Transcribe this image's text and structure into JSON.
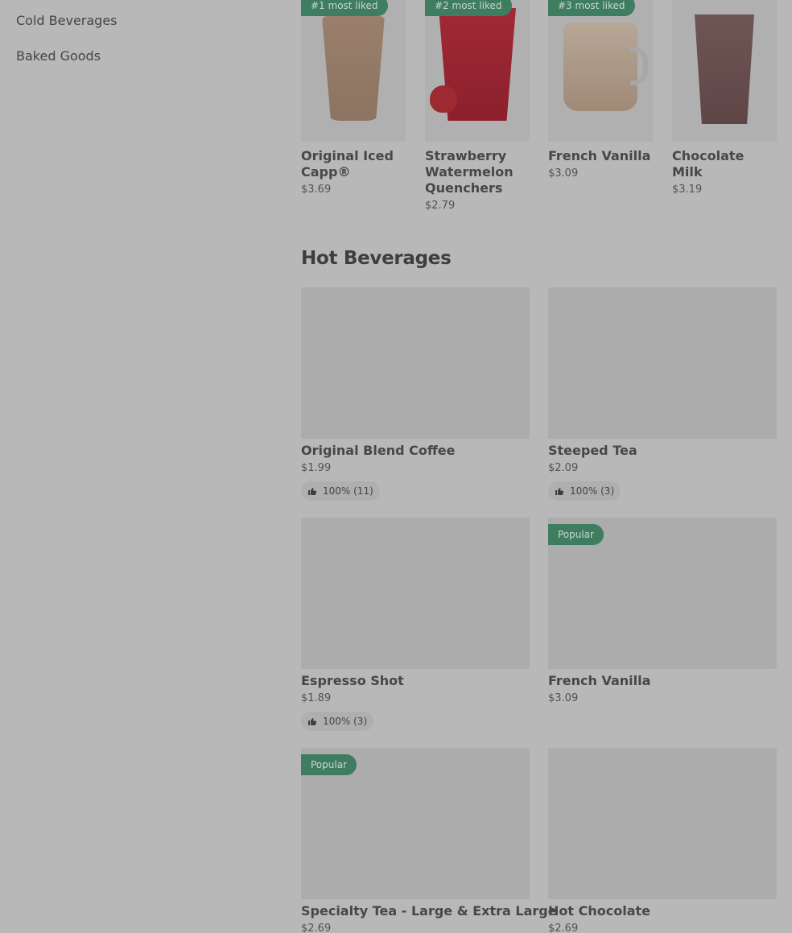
{
  "sidebar": {
    "items": [
      {
        "label": "Cold Beverages"
      },
      {
        "label": "Baked Goods"
      }
    ]
  },
  "most_liked": [
    {
      "badge": "#1 most liked",
      "title": "Original Iced Capp®",
      "price": "$3.69"
    },
    {
      "badge": "#2 most liked",
      "title": "Strawberry Watermelon Quenchers",
      "price": "$2.79"
    },
    {
      "badge": "#3 most liked",
      "title": "French Vanilla",
      "price": "$3.09"
    },
    {
      "badge": "",
      "title": "Chocolate Milk",
      "price": "$3.19"
    }
  ],
  "section": {
    "title": "Hot Beverages"
  },
  "products": [
    {
      "title": "Original Blend Coffee",
      "price": "$1.99",
      "rating": "100% (11)",
      "badge": ""
    },
    {
      "title": "Steeped Tea",
      "price": "$2.09",
      "rating": "100% (3)",
      "badge": ""
    },
    {
      "title": "Espresso Shot",
      "price": "$1.89",
      "rating": "100% (3)",
      "badge": ""
    },
    {
      "title": "French Vanilla",
      "price": "$3.09",
      "rating": "",
      "badge": "Popular"
    },
    {
      "title": "Specialty Tea - Large & Extra Large",
      "price": "$2.69",
      "rating": "",
      "badge": "Popular"
    },
    {
      "title": "Hot Chocolate",
      "price": "$2.69",
      "rating": "",
      "badge": ""
    }
  ],
  "colors": {
    "overlay_bg": "#b8b8b8",
    "badge_green": "#3e7d5f",
    "image_placeholder": "#acacac"
  },
  "icons": {
    "rating": "thumbs-up-icon"
  }
}
